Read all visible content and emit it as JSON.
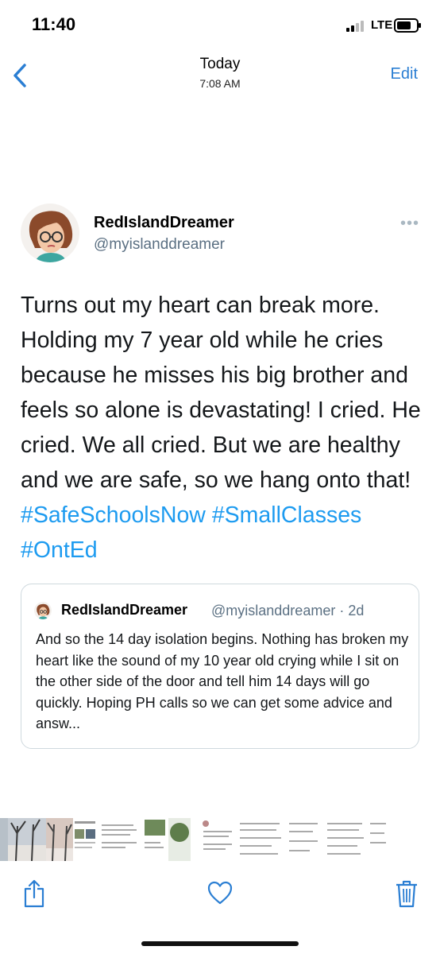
{
  "status_bar": {
    "time": "11:40",
    "network": "LTE"
  },
  "nav": {
    "title": "Today",
    "subtitle": "7:08 AM",
    "edit_label": "Edit"
  },
  "tweet": {
    "display_name": "RedIslandDreamer",
    "handle": "@myislanddreamer",
    "text": "Turns out my heart can break more. Holding my 7 year old while he cries because he misses his big brother and feels so alone is devastating! I cried. He cried. We all cried. But we are healthy and we are safe, so we hang onto that!",
    "hashtags": [
      "#SafeSchoolsNow",
      "#SmallClasses",
      "#OntEd"
    ]
  },
  "quoted_tweet": {
    "display_name": "RedIslandDreamer",
    "handle": "@myislanddreamer",
    "time": "2d",
    "text": "And so the 14 day isolation begins. Nothing has broken my heart like the sound of my 10 year old crying while I sit on the other side of the door and tell him 14 days will go quickly. Hoping PH calls so we can get some advice and answ..."
  },
  "colors": {
    "accent": "#2a7ed3",
    "hashtag": "#1d9bf0",
    "muted": "#5b7083",
    "border": "#cfd9de"
  },
  "icons": [
    "back-chevron-icon",
    "more-dots-icon",
    "share-icon",
    "heart-icon",
    "trash-icon"
  ]
}
